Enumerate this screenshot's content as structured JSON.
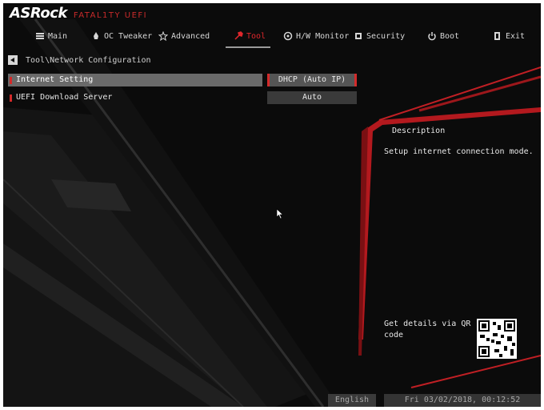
{
  "app": {
    "logo_brand": "ASRock",
    "logo_sub": "FATAL1TY UEFI"
  },
  "menu": [
    {
      "label": "Main",
      "icon": "list-icon",
      "active": false
    },
    {
      "label": "OC Tweaker",
      "icon": "rocket-icon",
      "active": false
    },
    {
      "label": "Advanced",
      "icon": "star-icon",
      "active": false
    },
    {
      "label": "Tool",
      "icon": "tool-icon",
      "active": true
    },
    {
      "label": "H/W Monitor",
      "icon": "monitor-icon",
      "active": false
    },
    {
      "label": "Security",
      "icon": "shield-icon",
      "active": false
    },
    {
      "label": "Boot",
      "icon": "power-icon",
      "active": false
    },
    {
      "label": "Exit",
      "icon": "exit-door-icon",
      "active": false
    }
  ],
  "breadcrumb": "Tool\\Network Configuration",
  "settings": [
    {
      "label": "Internet Setting",
      "value": "DHCP (Auto IP)",
      "selected": true
    },
    {
      "label": "UEFI Download Server",
      "value": "Auto",
      "selected": false
    }
  ],
  "description": {
    "title": "Description",
    "text": "Setup internet connection mode."
  },
  "qr": {
    "text": "Get details via QR code"
  },
  "footer": {
    "language": "English",
    "datetime": "Fri 03/02/2018, 00:12:52"
  },
  "colors": {
    "accent": "#d32a2a",
    "background": "#0b0b0b",
    "text": "#e6e6e6"
  }
}
